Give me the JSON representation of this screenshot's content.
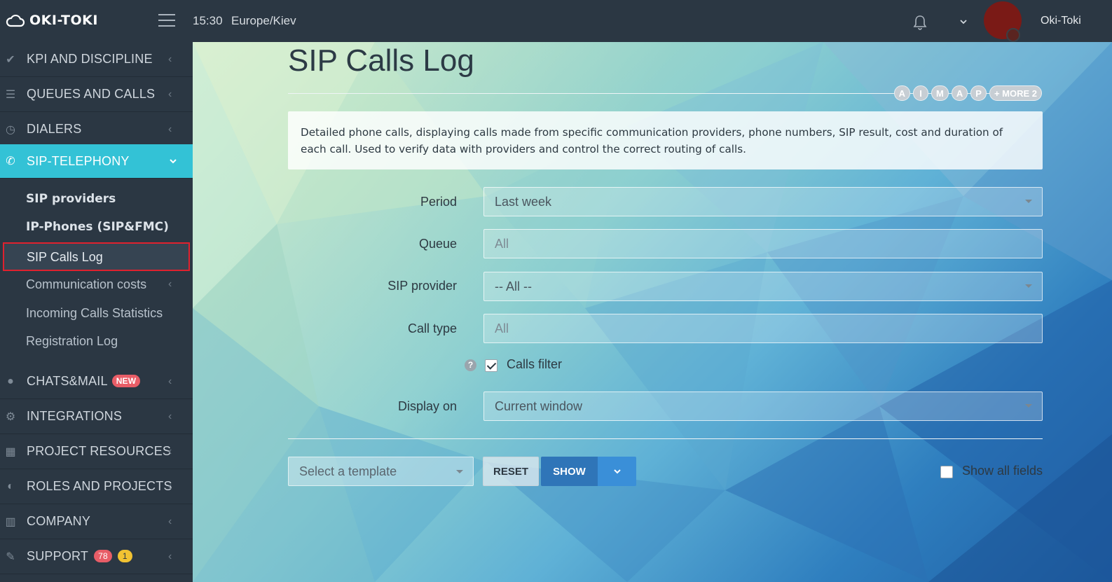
{
  "app": {
    "logo_text": "OKI-TOKI"
  },
  "header": {
    "time": "15:30",
    "timezone": "Europe/Kiev",
    "user_name": "Oki-Toki"
  },
  "sidebar": {
    "items": [
      {
        "label": "KPI AND DISCIPLINE",
        "icon": "check-icon"
      },
      {
        "label": "QUEUES AND CALLS",
        "icon": "list-icon"
      },
      {
        "label": "DIALERS",
        "icon": "clock-icon"
      },
      {
        "label": "SIP-TELEPHONY",
        "icon": "phone-icon",
        "active": true
      },
      {
        "label": "CHATS&MAIL",
        "icon": "chat-icon",
        "badge": "NEW"
      },
      {
        "label": "INTEGRATIONS",
        "icon": "gears-icon"
      },
      {
        "label": "PROJECT RESOURCES",
        "icon": "grid-icon"
      },
      {
        "label": "ROLES AND PROJECTS",
        "icon": "toggle-icon"
      },
      {
        "label": "COMPANY",
        "icon": "bar-chart-icon"
      },
      {
        "label": "SUPPORT",
        "icon": "wrench-icon",
        "badges": [
          "78",
          "1"
        ]
      }
    ],
    "sub_items": [
      {
        "label": "SIP providers"
      },
      {
        "label": "IP-Phones (SIP&FMC)"
      },
      {
        "label": "SIP Calls Log",
        "selected": true
      },
      {
        "label": "Communication costs"
      },
      {
        "label": "Incoming Calls Statistics"
      },
      {
        "label": "Registration Log"
      }
    ]
  },
  "main": {
    "title": "SIP Calls Log",
    "pills": [
      "A",
      "I",
      "M",
      "A",
      "P",
      "+ MORE 2"
    ],
    "description": "Detailed phone calls, displaying calls made from specific communication providers, phone numbers, SIP result, cost and duration of each call. Used to verify data with providers and control the correct routing of calls.",
    "form": {
      "period_label": "Period",
      "period_value": "Last week",
      "queue_label": "Queue",
      "queue_placeholder": "All",
      "sip_provider_label": "SIP provider",
      "sip_provider_value": "-- All --",
      "call_type_label": "Call type",
      "call_type_placeholder": "All",
      "calls_filter_label": "Calls filter",
      "calls_filter_checked": true,
      "display_on_label": "Display on",
      "display_on_value": "Current window"
    },
    "actions": {
      "template_placeholder": "Select a template",
      "reset_label": "RESET",
      "show_label": "SHOW",
      "show_all_fields_label": "Show all fields",
      "show_all_fields_checked": false
    }
  }
}
